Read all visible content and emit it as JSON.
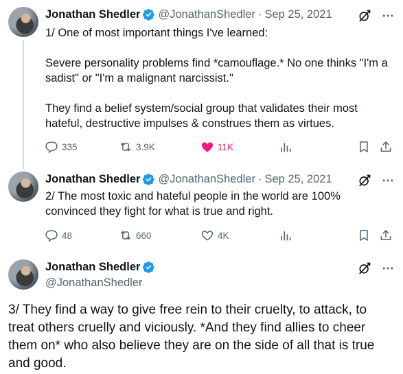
{
  "tweets": [
    {
      "name": "Jonathan Shedler",
      "handle": "@JonathanShedler",
      "date": "Sep 25, 2021",
      "text": "1/ One of most important things I've learned:\n\nSevere personality problems find *camouflage.* No one thinks \"I'm a sadist\" or \"I'm a malignant narcissist.\"\n\nThey find a belief system/social group that validates their most hateful, destructive impulses & construes them as virtues.",
      "replies": "335",
      "retweets": "3.9K",
      "likes": "11K"
    },
    {
      "name": "Jonathan Shedler",
      "handle": "@JonathanShedler",
      "date": "Sep 25, 2021",
      "text": "2/ The most toxic and hateful people in the world are 100% convinced they fight for what is true and right.",
      "replies": "48",
      "retweets": "660",
      "likes": "4K"
    },
    {
      "name": "Jonathan Shedler",
      "handle": "@JonathanShedler",
      "text": "3/ They find a way to give free rein to their cruelty, to attack, to treat others cruelly and viciously. *And they find allies to cheer them on* who also believe they are on the side of all that is true and good."
    }
  ],
  "colors": {
    "text": "#0f1419",
    "secondary": "#536471",
    "verified": "#1d9bf0",
    "like_active": "#f91880",
    "thread_line": "#cfd9de"
  },
  "icons": [
    "verified-badge-icon",
    "grok-icon",
    "more-icon",
    "reply-icon",
    "retweet-icon",
    "like-icon",
    "views-icon",
    "bookmark-icon",
    "share-icon"
  ]
}
